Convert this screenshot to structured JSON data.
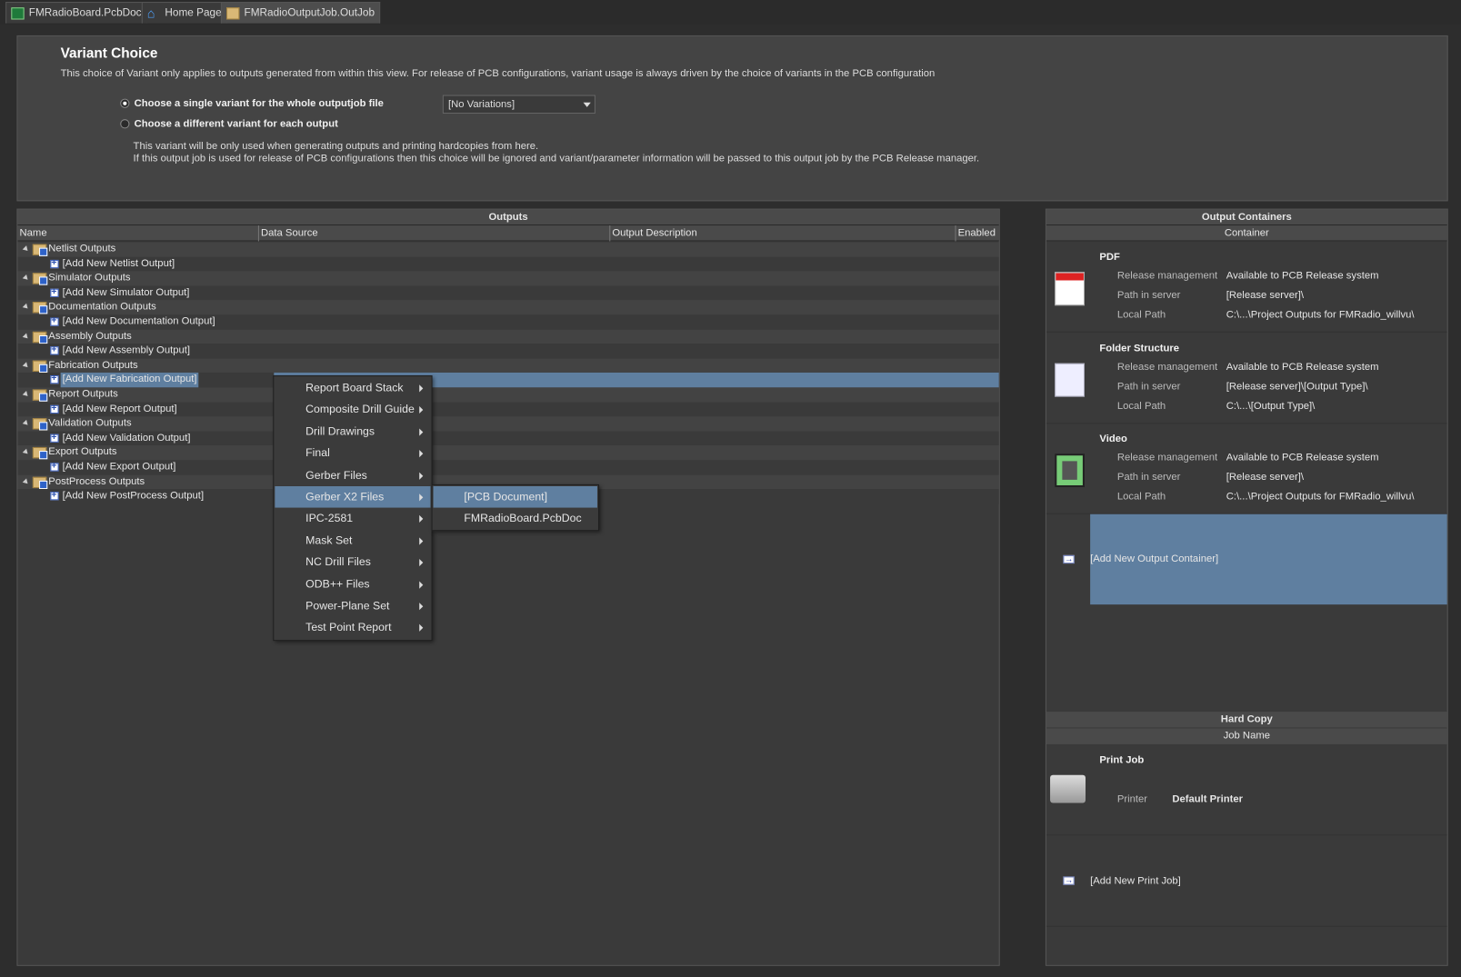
{
  "tabs": [
    {
      "label": "FMRadioBoard.PcbDoc",
      "icon": "pcb-icon"
    },
    {
      "label": "Home Page",
      "icon": "home-icon"
    },
    {
      "label": "FMRadioOutputJob.OutJob",
      "icon": "outjob-icon"
    }
  ],
  "variant": {
    "title": "Variant Choice",
    "description": "This choice of Variant only applies to outputs generated from within this view. For release of PCB configurations, variant usage is always driven by the choice of variants in the PCB configuration",
    "option_single": "Choose a single variant for the whole outputjob file",
    "option_each": "Choose a different variant for each output",
    "selected_option": "single",
    "select_value": "[No Variations]",
    "note1": "This variant will be only used when generating outputs and printing hardcopies from here.",
    "note2": "If this output job is used for release of PCB configurations then this choice will be ignored and variant/parameter information will be passed to this output job by the PCB Release manager."
  },
  "outputs": {
    "title": "Outputs",
    "columns": [
      "Name",
      "Data Source",
      "Output Description",
      "Enabled"
    ],
    "groups": [
      {
        "name": "Netlist Outputs",
        "add": "[Add New Netlist Output]"
      },
      {
        "name": "Simulator Outputs",
        "add": "[Add New Simulator Output]"
      },
      {
        "name": "Documentation Outputs",
        "add": "[Add New Documentation Output]"
      },
      {
        "name": "Assembly Outputs",
        "add": "[Add New Assembly Output]"
      },
      {
        "name": "Fabrication Outputs",
        "add": "[Add New Fabrication Output]",
        "selected": true
      },
      {
        "name": "Report Outputs",
        "add": "[Add New Report Output]"
      },
      {
        "name": "Validation Outputs",
        "add": "[Add New Validation Output]"
      },
      {
        "name": "Export Outputs",
        "add": "[Add New Export Output]"
      },
      {
        "name": "PostProcess Outputs",
        "add": "[Add New PostProcess Output]"
      }
    ]
  },
  "context_menu": {
    "items": [
      "Report Board Stack",
      "Composite Drill Guide",
      "Drill Drawings",
      "Final",
      "Gerber Files",
      "Gerber X2 Files",
      "IPC-2581",
      "Mask Set",
      "NC Drill Files",
      "ODB++ Files",
      "Power-Plane Set",
      "Test Point Report"
    ],
    "highlighted": "Gerber X2 Files",
    "submenu": [
      "[PCB Document]",
      "FMRadioBoard.PcbDoc"
    ],
    "submenu_highlighted": "[PCB Document]"
  },
  "containers": {
    "title": "Output Containers",
    "column": "Container",
    "labels": {
      "release": "Release management",
      "path_server": "Path in server",
      "local": "Local Path"
    },
    "items": [
      {
        "name": "PDF",
        "icon": "pdf-icon",
        "release": "Available to PCB Release system",
        "path_server": "[Release server]\\",
        "local": "C:\\...\\Project Outputs for FMRadio_willvu\\"
      },
      {
        "name": "Folder Structure",
        "icon": "document-icon",
        "release": "Available to PCB Release system",
        "path_server": "[Release server]\\[Output Type]\\",
        "local": "C:\\...\\[Output Type]\\"
      },
      {
        "name": "Video",
        "icon": "video-icon",
        "release": "Available to PCB Release system",
        "path_server": "[Release server]\\",
        "local": "C:\\...\\Project Outputs for FMRadio_willvu\\"
      }
    ],
    "add": "[Add New Output Container]"
  },
  "hardcopy": {
    "title": "Hard Copy",
    "column": "Job Name",
    "job": "Print Job",
    "printer_label": "Printer",
    "printer_value": "Default Printer",
    "add": "[Add New Print Job]"
  },
  "colors": {
    "selection": "#5f7fa0",
    "panel": "#3a3a3a",
    "header": "#4a4a4a"
  }
}
